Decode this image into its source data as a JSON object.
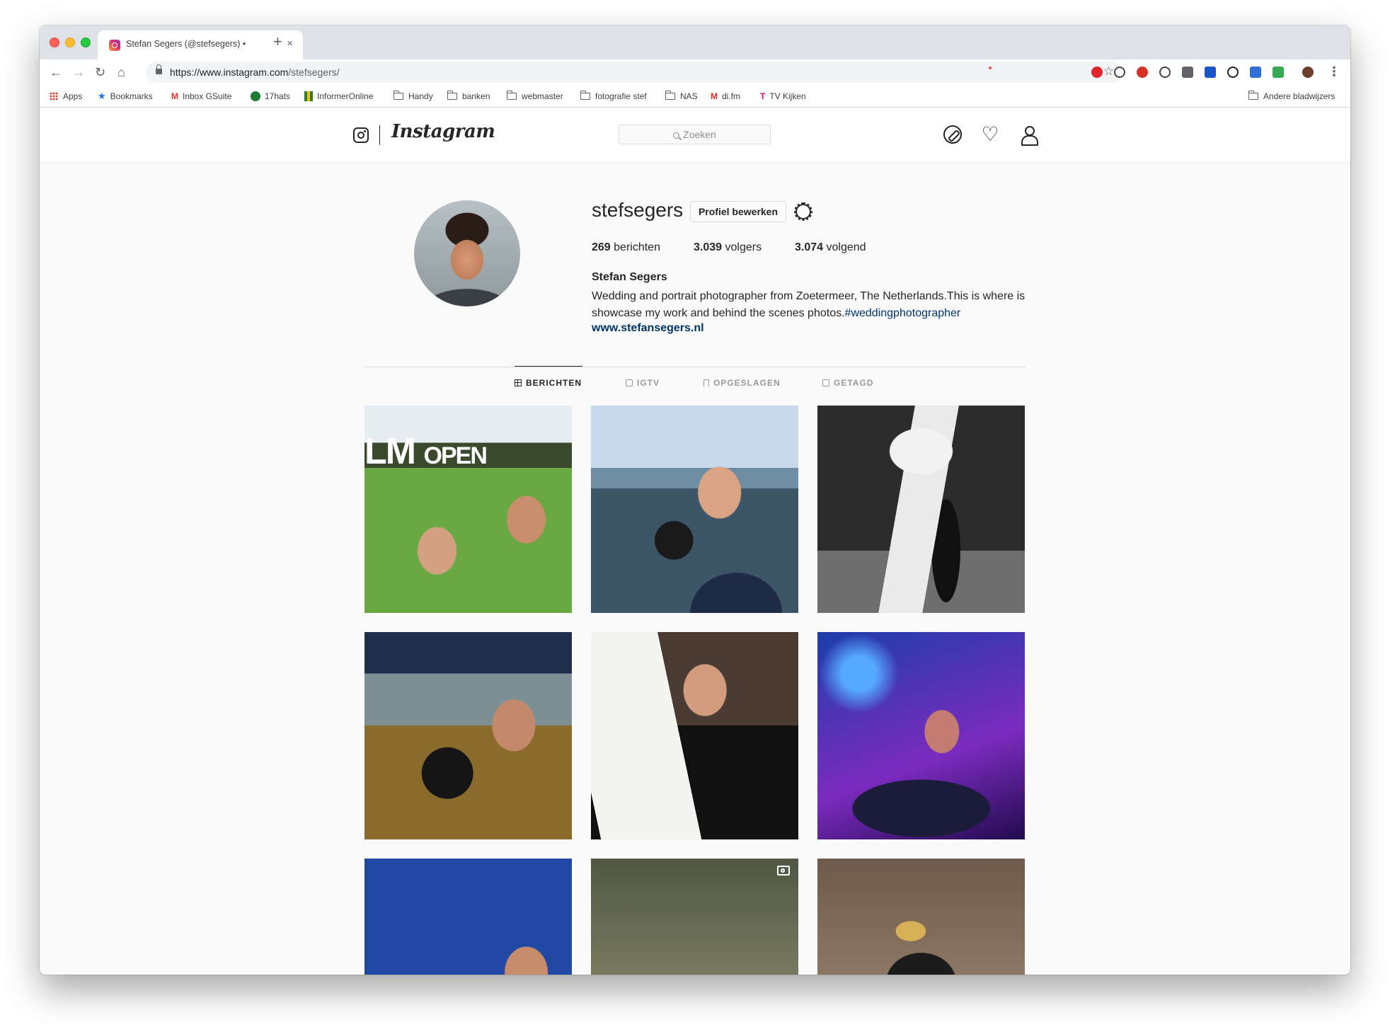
{
  "browser": {
    "tab_title": "Stefan Segers (@stefsegers) •",
    "new_tab_label": "+",
    "close_label": "×",
    "url_host": "https://www.instagram.com",
    "url_path": "/stefsegers/",
    "bookmarks": [
      {
        "label": "Apps",
        "icon": "apps-icon"
      },
      {
        "label": "Bookmarks",
        "icon": "star-icon"
      },
      {
        "label": "Inbox GSuite",
        "icon": "gmail-icon"
      },
      {
        "label": "17hats",
        "icon": "17hats-icon"
      },
      {
        "label": "InformerOnline",
        "icon": "informer-icon"
      },
      {
        "label": "Handy",
        "icon": "folder-icon"
      },
      {
        "label": "banken",
        "icon": "folder-icon"
      },
      {
        "label": "webmaster",
        "icon": "folder-icon"
      },
      {
        "label": "fotografie stef",
        "icon": "folder-icon"
      },
      {
        "label": "NAS",
        "icon": "folder-icon"
      },
      {
        "label": "di.fm",
        "icon": "gmail-icon"
      },
      {
        "label": "TV Kijken",
        "icon": "telekom-icon"
      }
    ],
    "other_bookmarks": "Andere bladwijzers"
  },
  "instagram": {
    "wordmark": "Instagram",
    "search_placeholder": "Zoeken",
    "profile": {
      "username": "stefsegers",
      "edit_button": "Profiel bewerken",
      "posts_count": "269",
      "posts_label": "berichten",
      "followers_count": "3.039",
      "followers_label": "volgers",
      "following_count": "3.074",
      "following_label": "volgend",
      "full_name": "Stefan Segers",
      "bio": "Wedding and portrait photographer from Zoetermeer, The Netherlands.This is where is showcase my work and behind the scenes photos.",
      "bio_hashtag": "#weddingphotographer",
      "website": "www.stefansegers.nl"
    },
    "tabs": [
      {
        "label": "BERICHTEN",
        "icon": "grid-icon",
        "active": true
      },
      {
        "label": "IGTV",
        "icon": "igtv-icon",
        "active": false
      },
      {
        "label": "OPGESLAGEN",
        "icon": "bookmark-icon",
        "active": false
      },
      {
        "label": "GETAGD",
        "icon": "tagged-icon",
        "active": false
      }
    ],
    "photo_1_text_big": "LM",
    "photo_1_text_small": "OPEN"
  },
  "colors": {
    "accent_link": "#003569",
    "notification": "#ed4956"
  }
}
